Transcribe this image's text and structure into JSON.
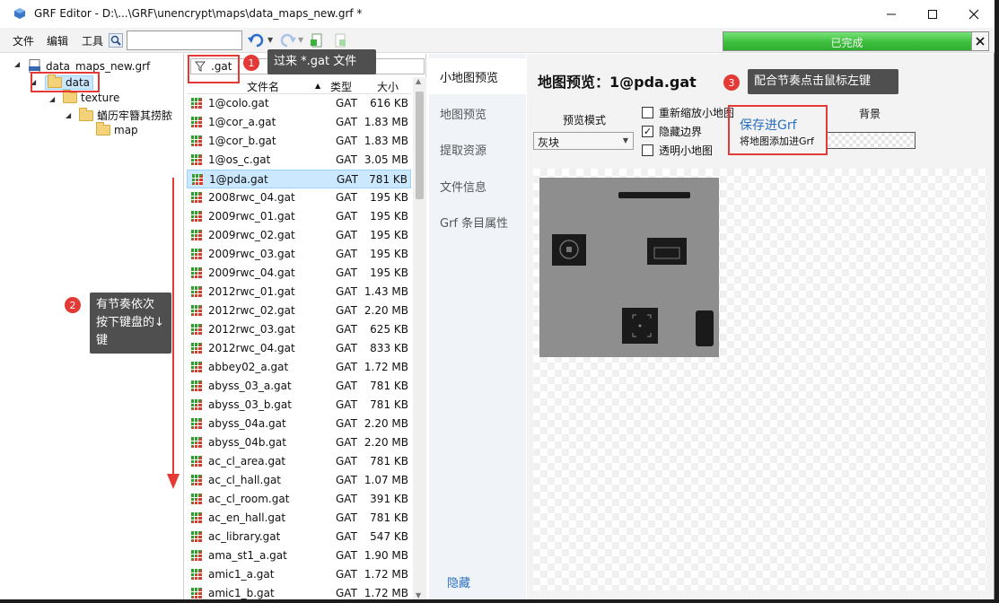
{
  "window": {
    "title": "GRF Editor - D:\\...\\GRF\\unencrypt\\maps\\data_maps_new.grf *"
  },
  "menu": {
    "file": "文件",
    "edit": "编辑",
    "tools": "工具",
    "search_value": ""
  },
  "status": {
    "progress_label": "已完成",
    "progress": 1.0
  },
  "tree": {
    "root": "data_maps_new.grf",
    "items": [
      {
        "label": "data"
      },
      {
        "label": "texture"
      },
      {
        "label": "蝤历牢簪其捞脓"
      },
      {
        "label": "map"
      }
    ]
  },
  "filelist": {
    "filter": ".gat",
    "headers": {
      "name": "文件名",
      "type": "类型",
      "size": "大小"
    },
    "rows": [
      {
        "name": "1@colo.gat",
        "type": "GAT",
        "size": "616 KB"
      },
      {
        "name": "1@cor_a.gat",
        "type": "GAT",
        "size": "1.83 MB"
      },
      {
        "name": "1@cor_b.gat",
        "type": "GAT",
        "size": "1.83 MB"
      },
      {
        "name": "1@os_c.gat",
        "type": "GAT",
        "size": "3.05 MB"
      },
      {
        "name": "1@pda.gat",
        "type": "GAT",
        "size": "781 KB",
        "selected": true
      },
      {
        "name": "2008rwc_04.gat",
        "type": "GAT",
        "size": "195 KB"
      },
      {
        "name": "2009rwc_01.gat",
        "type": "GAT",
        "size": "195 KB"
      },
      {
        "name": "2009rwc_02.gat",
        "type": "GAT",
        "size": "195 KB"
      },
      {
        "name": "2009rwc_03.gat",
        "type": "GAT",
        "size": "195 KB"
      },
      {
        "name": "2009rwc_04.gat",
        "type": "GAT",
        "size": "195 KB"
      },
      {
        "name": "2012rwc_01.gat",
        "type": "GAT",
        "size": "1.43 MB"
      },
      {
        "name": "2012rwc_02.gat",
        "type": "GAT",
        "size": "2.20 MB"
      },
      {
        "name": "2012rwc_03.gat",
        "type": "GAT",
        "size": "625 KB"
      },
      {
        "name": "2012rwc_04.gat",
        "type": "GAT",
        "size": "833 KB"
      },
      {
        "name": "abbey02_a.gat",
        "type": "GAT",
        "size": "1.72 MB"
      },
      {
        "name": "abyss_03_a.gat",
        "type": "GAT",
        "size": "781 KB"
      },
      {
        "name": "abyss_03_b.gat",
        "type": "GAT",
        "size": "781 KB"
      },
      {
        "name": "abyss_04a.gat",
        "type": "GAT",
        "size": "2.20 MB"
      },
      {
        "name": "abyss_04b.gat",
        "type": "GAT",
        "size": "2.20 MB"
      },
      {
        "name": "ac_cl_area.gat",
        "type": "GAT",
        "size": "781 KB"
      },
      {
        "name": "ac_cl_hall.gat",
        "type": "GAT",
        "size": "1.07 MB"
      },
      {
        "name": "ac_cl_room.gat",
        "type": "GAT",
        "size": "391 KB"
      },
      {
        "name": "ac_en_hall.gat",
        "type": "GAT",
        "size": "781 KB"
      },
      {
        "name": "ac_library.gat",
        "type": "GAT",
        "size": "547 KB"
      },
      {
        "name": "ama_st1_a.gat",
        "type": "GAT",
        "size": "1.90 MB"
      },
      {
        "name": "amic1_a.gat",
        "type": "GAT",
        "size": "1.72 MB"
      },
      {
        "name": "amic1_b.gat",
        "type": "GAT",
        "size": "1.72 MB"
      }
    ]
  },
  "sidetabs": {
    "items": [
      {
        "label": "小地图预览",
        "active": true
      },
      {
        "label": "地图预览"
      },
      {
        "label": "提取资源"
      },
      {
        "label": "文件信息"
      },
      {
        "label": "Grf 条目属性"
      }
    ],
    "hide": "隐藏"
  },
  "preview": {
    "title": "地图预览：1@pda.gat",
    "mode_label": "预览模式",
    "mode_value": "灰块",
    "options": [
      {
        "label": "重新缩放小地图",
        "checked": false
      },
      {
        "label": "隐藏边界",
        "checked": true
      },
      {
        "label": "透明小地图",
        "checked": false
      }
    ],
    "save_link": "保存进Grf",
    "save_desc": "将地图添加进Grf",
    "background_label": "背景"
  },
  "annotations": {
    "a1": {
      "num": "1",
      "text": "过来 *.gat 文件"
    },
    "a2": {
      "num": "2",
      "text": "有节奏依次按下键盘的↓键"
    },
    "a3": {
      "num": "3",
      "text": "配合节奏点击鼠标左键"
    }
  },
  "colors": {
    "accent_red": "#e53935",
    "progress_green": "#3dbf3d",
    "link_blue": "#2a6fbf",
    "selection": "#cce8ff"
  }
}
